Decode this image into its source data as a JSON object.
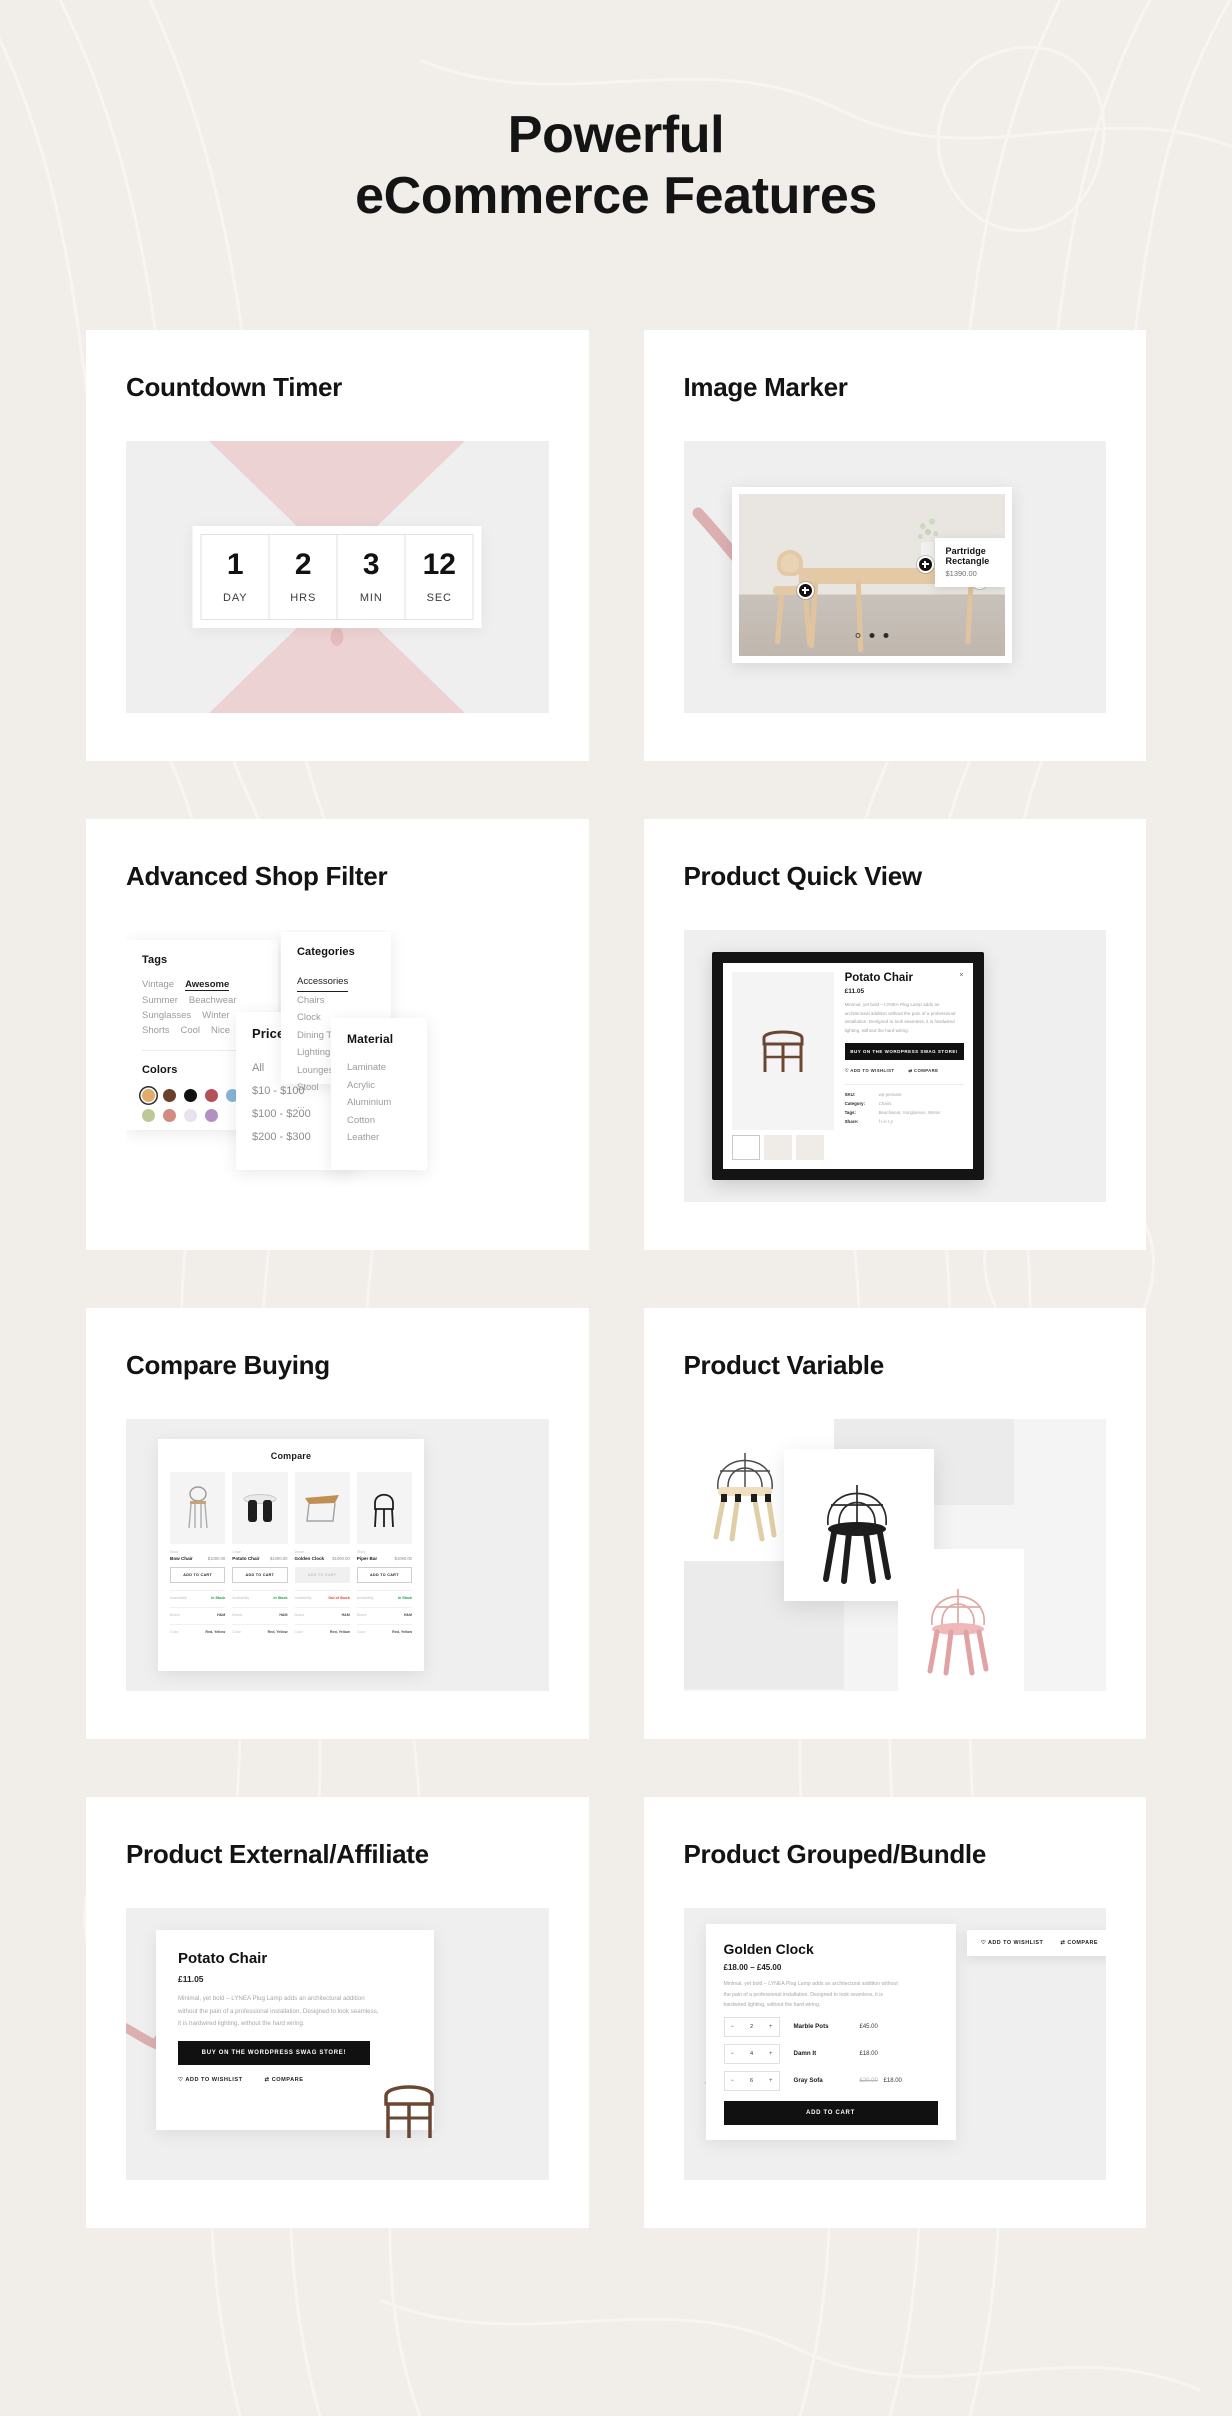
{
  "heading": {
    "line1": "Powerful",
    "line2": "eCommerce Features"
  },
  "colors": {
    "page_bg": "#f1eeea",
    "card_bg": "#ffffff",
    "stage_bg": "#efefef",
    "text": "#131313",
    "accent_pink": "#dbacac",
    "in_stock": "#1a9a3e",
    "out_of_stock": "#e03b2f",
    "dark_button": "#111111"
  },
  "cards": {
    "countdown": {
      "title": "Countdown Timer",
      "units": [
        {
          "value": "1",
          "label": "DAY"
        },
        {
          "value": "2",
          "label": "HRS"
        },
        {
          "value": "3",
          "label": "MIN"
        },
        {
          "value": "12",
          "label": "SEC"
        }
      ]
    },
    "image_marker": {
      "title": "Image Marker",
      "tooltip": {
        "name": "Partridge Rectangle",
        "price": "$1390.00"
      },
      "dots": 3
    },
    "shop_filter": {
      "title": "Advanced Shop Filter",
      "tags_heading": "Tags",
      "tags": [
        "Vintage",
        "Awesome",
        "Summer",
        "Beachwear",
        "Sunglasses",
        "Winter",
        "Shorts",
        "Cool",
        "Nice"
      ],
      "tags_active": "Awesome",
      "colors_heading": "Colors",
      "swatches": [
        "#e0ab6d",
        "#6b3f2a",
        "#111111",
        "#b3505a",
        "#86b6d8",
        "#bcc897",
        "#d18b81",
        "#e8e2ee",
        "#b191c4"
      ],
      "swatch_selected_index": 0,
      "price_heading": "Price",
      "price_options": [
        "All",
        "$10 - $100",
        "$100 - $200",
        "$200 - $300"
      ],
      "categories_heading": "Categories",
      "categories": [
        "Accessories",
        "Chairs",
        "Clock",
        "Dining Table",
        "Lighting",
        "Lounges & Sofas",
        "Stool",
        "..."
      ],
      "categories_active": "Accessories",
      "material_heading": "Material",
      "materials": [
        "Laminate",
        "Acrylic",
        "Aluminium",
        "Cotton",
        "Leather"
      ]
    },
    "quick_view": {
      "title": "Product Quick View",
      "product_name": "Potato Chair",
      "price": "£11.05",
      "description": "Minimal, yet bold – LYNEA Plug Lamp adds an architectural addition without the pain of a professional installation. Designed to look seamless, it is hardwired lighting, without the hard wiring.",
      "buy_button": "BUY ON THE WORDPRESS SWAG STORE!",
      "wishlist": "ADD TO WISHLIST",
      "compare": "COMPARE",
      "close": "×",
      "search": "⌕",
      "meta": [
        {
          "key": "SKU:",
          "value": "wp-pennant"
        },
        {
          "key": "Category:",
          "value": "Chairs"
        },
        {
          "key": "Tags:",
          "value": "Beachwear, Sunglasses, Winter"
        },
        {
          "key": "Share:",
          "value": "f  t  in  t  p"
        }
      ]
    },
    "compare": {
      "title": "Compare Buying",
      "panel_title": "Compare",
      "add_to_cart": "ADD TO CART",
      "attr_labels": [
        "Availability",
        "Brand",
        "Color"
      ],
      "products": [
        {
          "category": "Stool",
          "name": "Bow Chair",
          "price": "$1090.00",
          "availability": "In Stock",
          "in_stock": true,
          "brand": "H&M",
          "color": "Red, Yellow",
          "disabled": false
        },
        {
          "category": "Chair",
          "name": "Potato Chair",
          "price": "$1090.00",
          "availability": "In Stock",
          "in_stock": true,
          "brand": "H&M",
          "color": "Red, Yellow",
          "disabled": false
        },
        {
          "category": "Decor",
          "name": "Golden Clock",
          "price": "$1090.00",
          "availability": "Out of Stock",
          "in_stock": false,
          "brand": "H&M",
          "color": "Red, Yellow",
          "disabled": true
        },
        {
          "category": "Stool",
          "name": "Piper Bar",
          "price": "$1090.00",
          "availability": "In Stock",
          "in_stock": true,
          "brand": "H&M",
          "color": "Red, Yellow",
          "disabled": false
        }
      ]
    },
    "product_variable": {
      "title": "Product Variable",
      "variants": [
        "natural wood",
        "black",
        "pink"
      ]
    },
    "product_external": {
      "title": "Product External/Affiliate",
      "product_name": "Potato Chair",
      "price": "£11.05",
      "description": "Minimal, yet bold – LYNEA Plug Lamp adds an architectural addition without the pain of a professional installation. Designed to look seamless, it is hardwired lighting, without the hard wiring.",
      "buy_button": "BUY ON THE WORDPRESS SWAG STORE!",
      "wishlist": "ADD TO WISHLIST",
      "compare": "COMPARE"
    },
    "product_grouped": {
      "title": "Product Grouped/Bundle",
      "product_name": "Golden Clock",
      "price": "£18.00 – £45.00",
      "description": "Minimal, yet bold – LYNEA Plug Lamp adds an architectural addition without the pain of a professional installation. Designed to look seamless, it is hardwired lighting, without the hard wiring.",
      "wishlist": "ADD TO WISHLIST",
      "compare": "COMPARE",
      "add_to_cart": "ADD TO CART",
      "items": [
        {
          "qty": "2",
          "name": "Marble Pots",
          "price": "£45.00",
          "old_price": ""
        },
        {
          "qty": "4",
          "name": "Damn It",
          "price": "£18.00",
          "old_price": ""
        },
        {
          "qty": "6",
          "name": "Gray Sofa",
          "price": "£18.00",
          "old_price": "£20.00"
        }
      ]
    }
  }
}
